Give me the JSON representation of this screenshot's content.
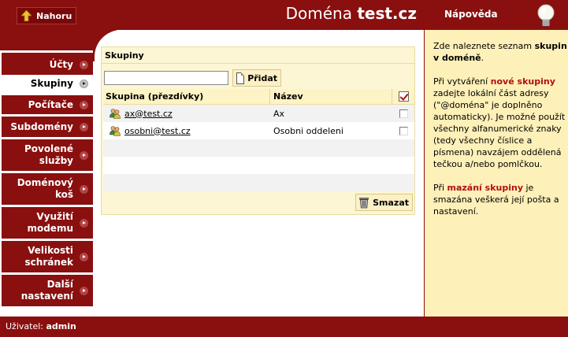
{
  "header": {
    "up_label": "Nahoru",
    "domain_prefix": "Doména",
    "domain_name": "test.cz"
  },
  "sidebar": {
    "items": [
      {
        "label": "Účty",
        "active": false
      },
      {
        "label": "Skupiny",
        "active": true
      },
      {
        "label": "Počítače",
        "active": false
      },
      {
        "label": "Subdomény",
        "active": false
      },
      {
        "label": "Povolené služby",
        "active": false
      },
      {
        "label": "Doménový koš",
        "active": false
      },
      {
        "label": "Využití modemu",
        "active": false
      },
      {
        "label": "Velikosti schránek",
        "active": false
      },
      {
        "label": "Další nastavení",
        "active": false
      }
    ]
  },
  "panel": {
    "title": "Skupiny",
    "input_value": "",
    "add_label": "Přidat",
    "delete_label": "Smazat",
    "columns": [
      "Skupina (přezdívky)",
      "Název"
    ],
    "rows": [
      {
        "group": "ax@test.cz",
        "name": "Ax"
      },
      {
        "group": "osobni@test.cz",
        "name": "Osobni oddeleni"
      }
    ]
  },
  "footer": {
    "user_label": "Uživatel:",
    "user_name": "admin"
  },
  "help": {
    "title": "Nápověda",
    "p1_a": "Zde naleznete seznam ",
    "p1_b": "skupin v doméně",
    "p1_c": ".",
    "p2_a": "Při vytváření ",
    "p2_b": "nové skupiny",
    "p2_c": " zadejte lokální část adresy (\"@doména\" je doplněno automaticky). Je možné použít všechny alfanumerické znaky (tedy všechny číslice a písmena) navzájem oddělená tečkou a/nebo pomlčkou.",
    "p3_a": "Při ",
    "p3_b": "mazání skupiny",
    "p3_c": " je smazána veškerá její pošta a nastavení."
  },
  "colors": {
    "brand": "#8a0f0f",
    "panel_bg": "#fdf6d4",
    "help_bg": "#fdf0b8",
    "accent_red": "#b01010"
  }
}
